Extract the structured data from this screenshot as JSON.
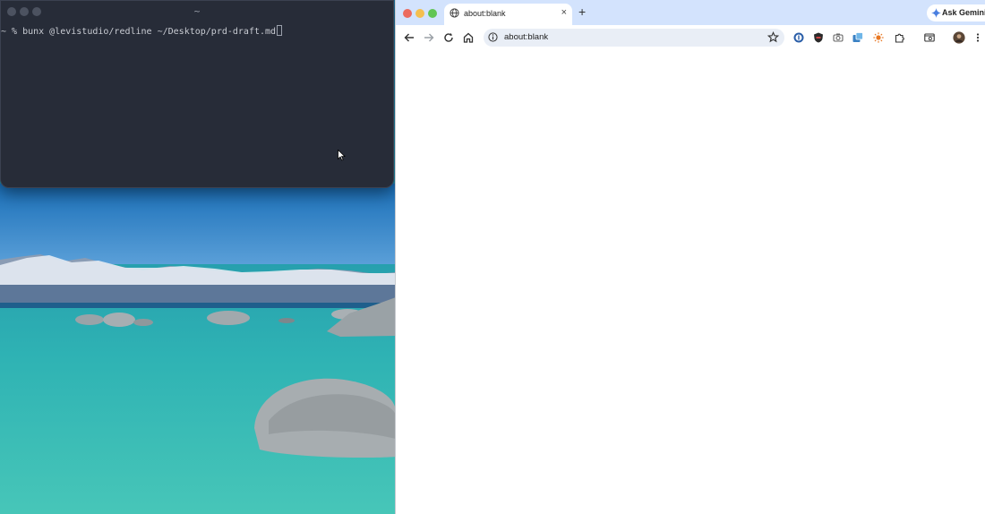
{
  "terminal": {
    "title": "~",
    "prompt_line": "~ % bunx @levistudio/redline ~/Desktop/prd-draft.md"
  },
  "browser": {
    "tab_title": "about:blank",
    "new_tab_label": "+",
    "close_label": "×",
    "ask_gemini_label": "Ask Gemini",
    "url": "about:blank"
  },
  "colors": {
    "terminal_bg": "#272c38",
    "tabstrip_bg": "#d3e3fd",
    "omnibox_bg": "#e9eef6",
    "close_red": "#ec6a5e",
    "minimize_yellow": "#f4bf4f",
    "zoom_green": "#61c554"
  },
  "icons": [
    "globe-icon",
    "close-icon",
    "plus-icon",
    "gemini-spark-icon",
    "back-arrow-icon",
    "forward-arrow-icon",
    "reload-icon",
    "home-icon",
    "site-info-icon",
    "bookmark-star-icon",
    "password-manager-icon",
    "shield-icon",
    "camera-icon",
    "extension-square-icon",
    "sun-icon",
    "puzzle-icon",
    "tab-search-icon",
    "avatar",
    "more-menu-icon",
    "mouse-pointer-icon"
  ]
}
